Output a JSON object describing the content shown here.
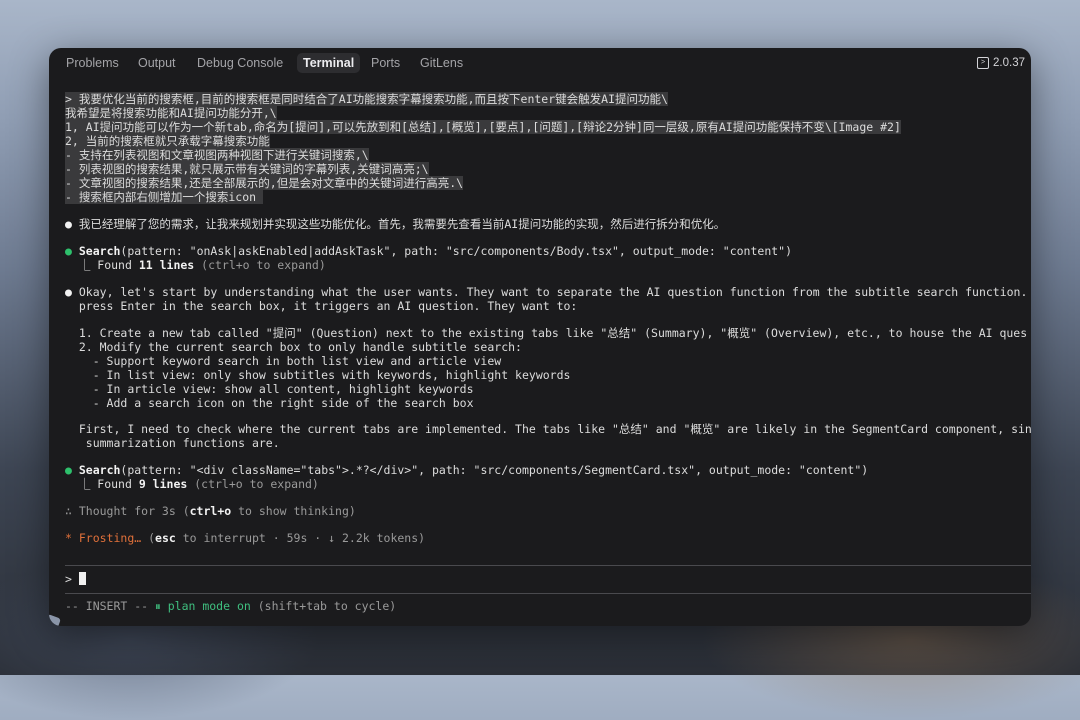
{
  "tabs": [
    {
      "label": "Problems"
    },
    {
      "label": "Output"
    },
    {
      "label": "Debug Console"
    },
    {
      "label": "Terminal",
      "active": true
    },
    {
      "label": "Ports"
    },
    {
      "label": "GitLens"
    }
  ],
  "version": "2.0.37",
  "prompt": {
    "lines": [
      "> 我要优化当前的搜索框,目前的搜索框是同时结合了AI功能搜索字幕搜索功能,而且按下enter键会触发AI提问功能\\",
      "我希望是将搜索功能和AI提问功能分开,\\",
      "1, AI提问功能可以作为一个新tab,命名为[提问],可以先放到和[总结],[概览],[要点],[问题],[辩论2分钟]同一层级,原有AI提问功能保持不变\\[Image #2]",
      "2, 当前的搜索框就只承载字幕搜索功能",
      "- 支持在列表视图和文章视图两种视图下进行关键词搜索,\\",
      "- 列表视图的搜索结果,就只展示带有关键词的字幕列表,关键词高亮;\\",
      "- 文章视图的搜索结果,还是全部展示的,但是会对文章中的关键词进行高亮.\\",
      "- 搜索框内部右侧增加一个搜索icon "
    ]
  },
  "response1": "我已经理解了您的需求，让我来规划并实现这些功能优化。首先，我需要先查看当前AI提问功能的实现，然后进行拆分和优化。",
  "tool1": {
    "name": "Search",
    "args": "(pattern: \"onAsk|askEnabled|addAskTask\", path: \"src/components/Body.tsx\", output_mode: \"content\")",
    "result_prefix": "⎿ Found ",
    "result_count": "11 lines",
    "result_suffix": " (ctrl+o to expand)"
  },
  "thinking": {
    "lines": [
      "Okay, let's start by understanding what the user wants. They want to separate the AI question function from the subtitle search function. C",
      "press Enter in the search box, it triggers an AI question. They want to:",
      "",
      "1. Create a new tab called \"提问\" (Question) next to the existing tabs like \"总结\" (Summary), \"概览\" (Overview), etc., to house the AI ques",
      "2. Modify the current search box to only handle subtitle search:",
      "  - Support keyword search in both list view and article view",
      "  - In list view: only show subtitles with keywords, highlight keywords",
      "  - In article view: show all content, highlight keywords",
      "  - Add a search icon on the right side of the search box",
      "",
      "First, I need to check where the current tabs are implemented. The tabs like \"总结\" and \"概览\" are likely in the SegmentCard component, sin",
      " summarization functions are."
    ]
  },
  "tool2": {
    "name": "Search",
    "args": "(pattern: \"<div className=\"tabs\">.*?</div>\", path: \"src/components/SegmentCard.tsx\", output_mode: \"content\")",
    "result_prefix": "⎿ Found ",
    "result_count": "9 lines",
    "result_suffix": " (ctrl+o to expand)"
  },
  "thought": {
    "prefix": "∴ Thought for 3s (",
    "key": "ctrl+o",
    "suffix": " to show thinking)"
  },
  "status": {
    "star": "*",
    "word": "Frosting…",
    "open": " (",
    "key": "esc",
    "rest": " to interrupt · 59s · ↓ 2.2k tokens)"
  },
  "input": {
    "prompt_char": ">"
  },
  "footer": {
    "mode": "-- INSERT --",
    "pause_icon": "⏸",
    "plan": "plan mode on",
    "hint": " (shift+tab to cycle)"
  }
}
